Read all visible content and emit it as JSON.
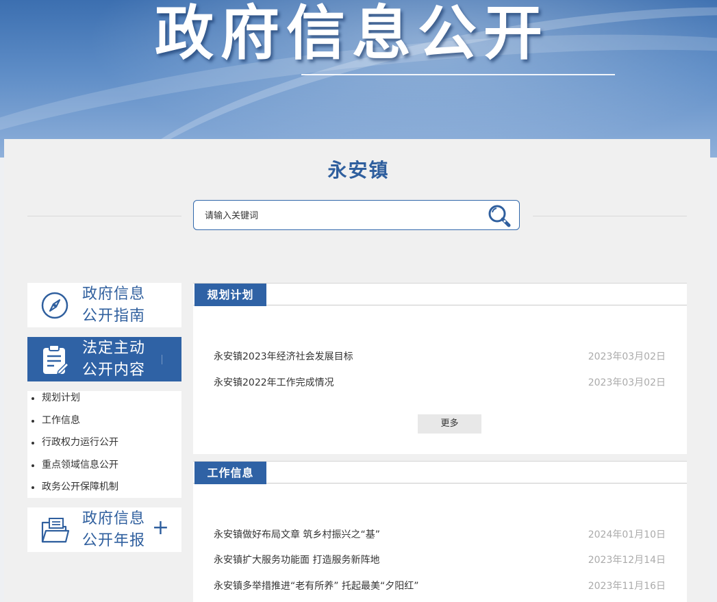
{
  "banner": {
    "title": "政府信息公开"
  },
  "town": {
    "name": "永安镇"
  },
  "search": {
    "placeholder": "请输入关键词"
  },
  "sidebar": {
    "guide_label": "政府信息公开指南",
    "content_label": "法定主动公开内容",
    "annual_label": "政府信息公开年报",
    "submenu": [
      "规划计划",
      "工作信息",
      "行政权力运行公开",
      "重点领域信息公开",
      "政务公开保障机制"
    ]
  },
  "sections": [
    {
      "title": "规划计划",
      "items": [
        {
          "title": "永安镇2023年经济社会发展目标",
          "date": "2023年03月02日"
        },
        {
          "title": "永安镇2022年工作完成情况",
          "date": "2023年03月02日"
        }
      ],
      "more_label": "更多"
    },
    {
      "title": "工作信息",
      "items": [
        {
          "title": "永安镇做好布局文章  筑乡村振兴之“基”",
          "date": "2024年01月10日"
        },
        {
          "title": "永安镇扩大服务功能面 打造服务新阵地",
          "date": "2023年12月14日"
        },
        {
          "title": "永安镇多举措推进“老有所养”  托起最美“夕阳红”",
          "date": "2023年11月16日"
        }
      ]
    }
  ],
  "colors": {
    "primary": "#2f62a5",
    "date": "#aaaaaa"
  },
  "icons": [
    "compass-icon",
    "clipboard-icon",
    "folder-icon",
    "search-icon"
  ]
}
